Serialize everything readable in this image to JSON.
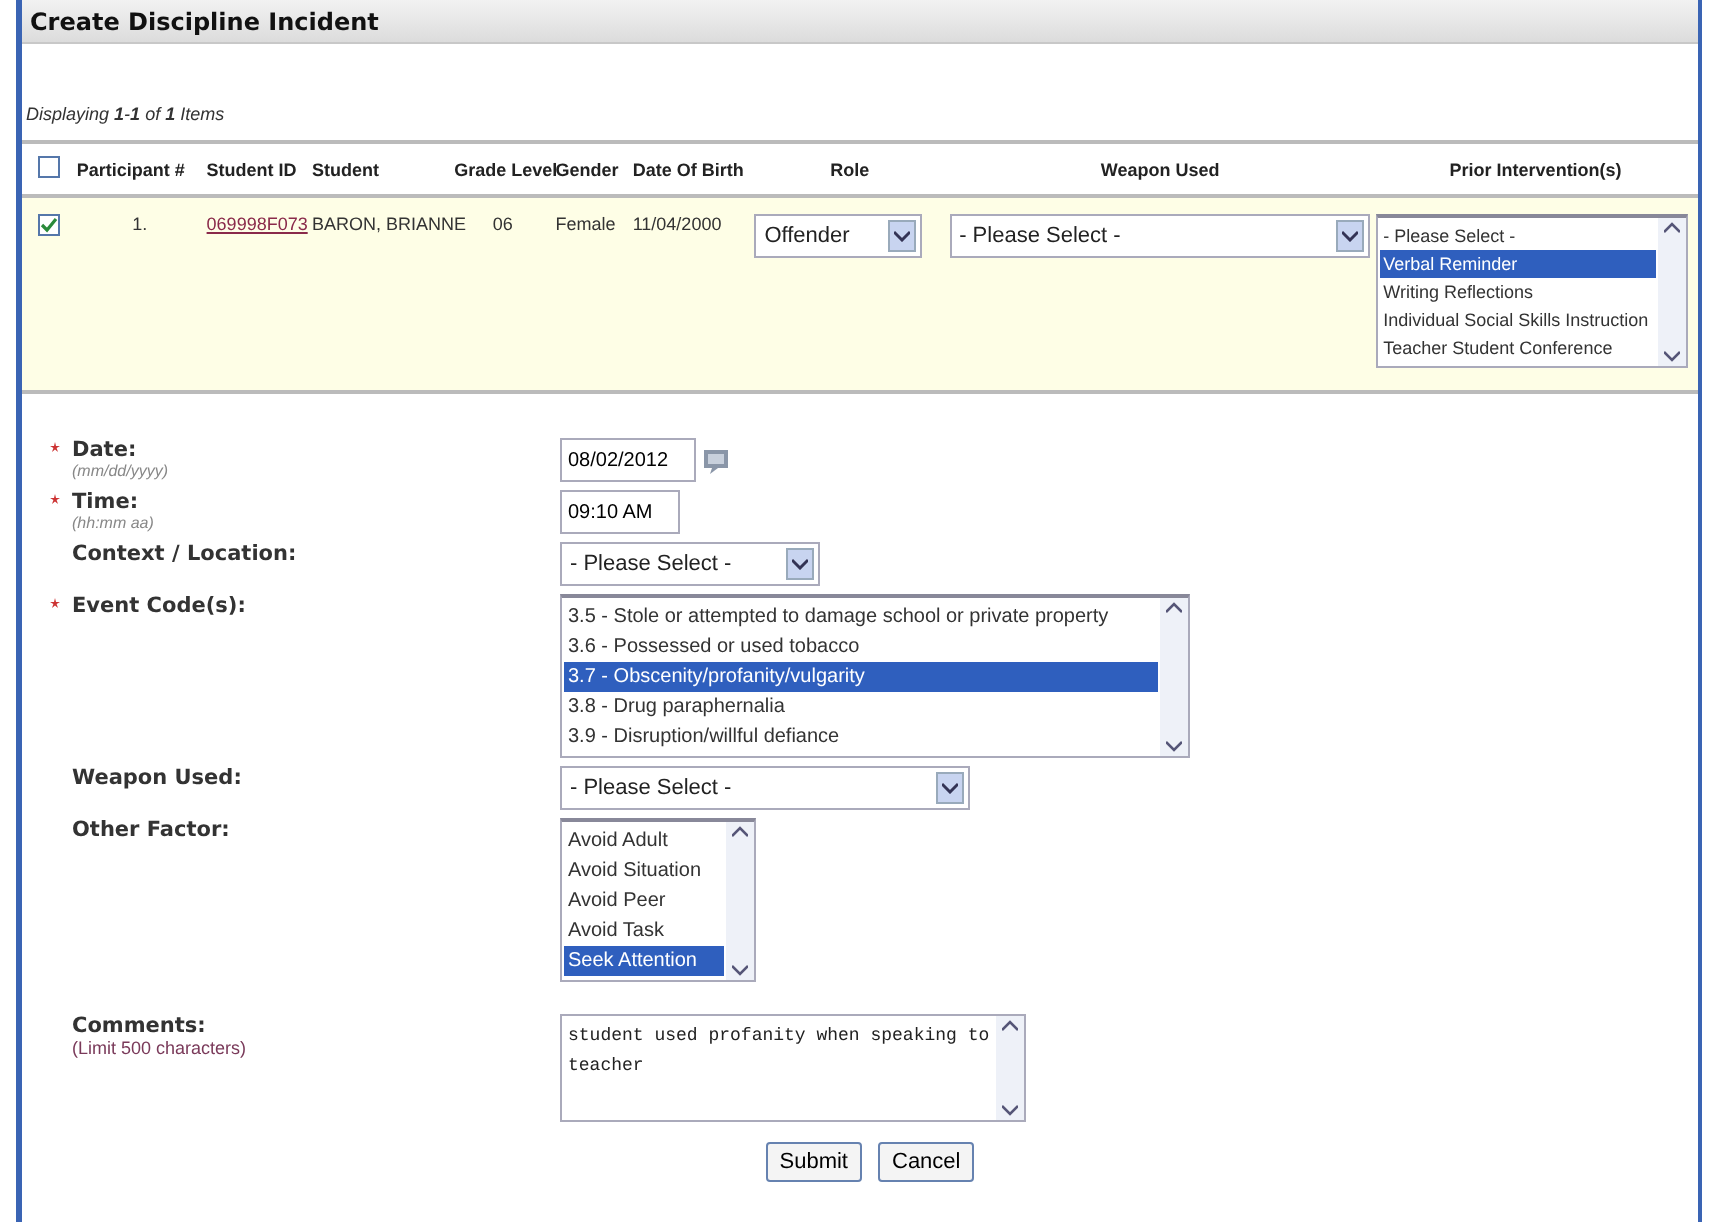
{
  "title": "Create Discipline Incident",
  "pager": "Displaying **1**-**1** of **1** Items",
  "table": {
    "select_all": {
      "checked": false
    },
    "columns": [
      "Participant #",
      "Student ID",
      "Student",
      "Grade Level",
      "Gender",
      "Date Of Birth",
      "Role",
      "Weapon Used",
      "Prior Intervention(s)"
    ],
    "rows": [
      {
        "checked": true,
        "participant": "1.",
        "student_id": "069998F073",
        "student": "BARON, BRIANNE",
        "grade": "06",
        "gender": "Female",
        "dob": "11/04/2000",
        "role": "Offender",
        "weapon": "- Please Select -",
        "prior": [
          {
            "label": "- Please Select -",
            "selected": false
          },
          {
            "label": "Verbal Reminder",
            "selected": true
          },
          {
            "label": "Writing Reflections",
            "selected": false
          },
          {
            "label": "Individual Social Skills Instruction",
            "selected": false
          },
          {
            "label": "Teacher Student Conference",
            "selected": false
          }
        ]
      }
    ]
  },
  "form": [
    {
      "kind": "date",
      "label": "Date:",
      "required": true,
      "hint": "(mm/dd/yyyy)",
      "value": "08/02/2012"
    },
    {
      "kind": "time",
      "label": "Time:",
      "required": true,
      "hint": "(hh:mm aa)",
      "value": "09:10 AM"
    },
    {
      "kind": "select",
      "label": "Context / Location:",
      "required": false,
      "value": "- Please Select -"
    },
    {
      "kind": "listbox",
      "label": "Event Code(s):",
      "required": true,
      "options": [
        {
          "label": "3.5 - Stole or attempted to damage school or private property",
          "selected": false
        },
        {
          "label": "3.6 - Possessed or used tobacco",
          "selected": false
        },
        {
          "label": "3.7 - Obscenity/profanity/vulgarity",
          "selected": true
        },
        {
          "label": "3.8 - Drug paraphernalia",
          "selected": false
        },
        {
          "label": "3.9 - Disruption/willful defiance",
          "selected": false
        }
      ]
    },
    {
      "kind": "select",
      "label": "Weapon Used:",
      "required": false,
      "value": "- Please Select -"
    },
    {
      "kind": "listbox",
      "label": "Other Factor:",
      "required": false,
      "options": [
        {
          "label": "Avoid Adult",
          "selected": false
        },
        {
          "label": "Avoid Situation",
          "selected": false
        },
        {
          "label": "Avoid Peer",
          "selected": false
        },
        {
          "label": "Avoid Task",
          "selected": false
        },
        {
          "label": "Seek Attention",
          "selected": true
        }
      ]
    },
    {
      "kind": "textarea",
      "label": "Comments:",
      "required": false,
      "hint": "(Limit 500 characters)",
      "value": "student used profanity when speaking to teacher"
    }
  ],
  "buttons": [
    "Submit",
    "Cancel"
  ]
}
